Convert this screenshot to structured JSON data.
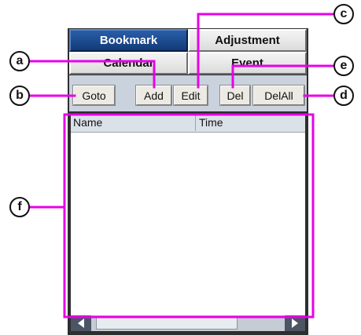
{
  "tabs": [
    {
      "label": "Bookmark",
      "active": true
    },
    {
      "label": "Adjustment",
      "active": false
    },
    {
      "label": "Calendar",
      "active": false
    },
    {
      "label": "Event",
      "active": false
    }
  ],
  "toolbar": {
    "goto": "Goto",
    "add": "Add",
    "edit": "Edit",
    "del": "Del",
    "delall": "DelAll"
  },
  "list": {
    "columns": [
      "Name",
      "Time"
    ],
    "rows": []
  },
  "callouts": {
    "a": "a",
    "b": "b",
    "c": "c",
    "d": "d",
    "e": "e",
    "f": "f"
  },
  "colors": {
    "callout_line": "#e800e8",
    "active_tab": "#1a4a8f",
    "toolbar_bg": "#c9d2dd"
  },
  "icons": {
    "scroll_left": "triangle-left-icon",
    "scroll_right": "triangle-right-icon"
  }
}
